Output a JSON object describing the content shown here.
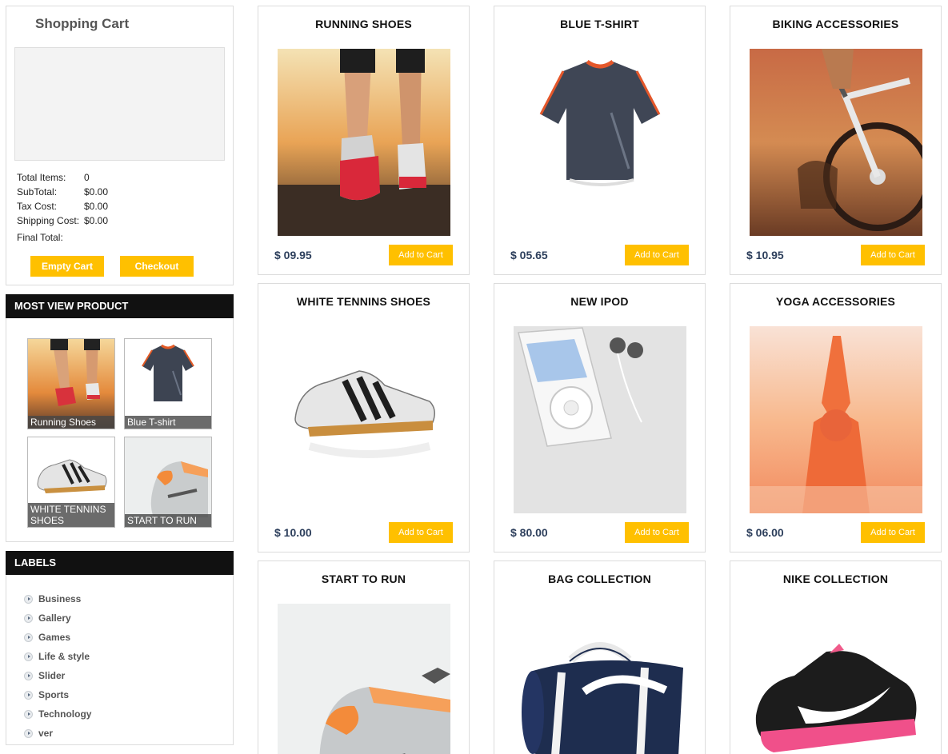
{
  "cart": {
    "title": "Shopping Cart",
    "rows": [
      {
        "label": "Total Items:",
        "value": "0"
      },
      {
        "label": "SubTotal:",
        "value": "$0.00"
      },
      {
        "label": "Tax Cost:",
        "value": "$0.00"
      },
      {
        "label": "Shipping Cost:",
        "value": "$0.00"
      },
      {
        "label": "Final Total:",
        "value": ""
      }
    ],
    "empty_label": "Empty Cart",
    "checkout_label": "Checkout"
  },
  "most_view": {
    "heading": "MOST VIEW PRODUCT",
    "items": [
      {
        "caption": "Running Shoes"
      },
      {
        "caption": "Blue T-shirt"
      },
      {
        "caption": "WHITE TENNINS SHOES"
      },
      {
        "caption": "START TO RUN"
      }
    ]
  },
  "labels": {
    "heading": "LABELS",
    "items": [
      "Business",
      "Gallery",
      "Games",
      "Life & style",
      "Slider",
      "Sports",
      "Technology",
      "ver"
    ]
  },
  "products": [
    {
      "title": "RUNNING SHOES",
      "price": "$ 09.95",
      "button": "Add to Cart"
    },
    {
      "title": "BLUE T-SHIRT",
      "price": "$ 05.65",
      "button": "Add to Cart"
    },
    {
      "title": "BIKING ACCESSORIES",
      "price": "$ 10.95",
      "button": "Add to Cart"
    },
    {
      "title": "WHITE TENNINS SHOES",
      "price": "$ 10.00",
      "button": "Add to Cart"
    },
    {
      "title": "NEW IPOD",
      "price": "$ 80.00",
      "button": "Add to Cart"
    },
    {
      "title": "YOGA ACCESSORIES",
      "price": "$ 06.00",
      "button": "Add to Cart"
    },
    {
      "title": "START TO RUN"
    },
    {
      "title": "BAG COLLECTION"
    },
    {
      "title": "NIKE COLLECTION"
    }
  ],
  "colors": {
    "accent": "#ffc000",
    "header_bg": "#111111",
    "price_text": "#2d3f5c"
  }
}
